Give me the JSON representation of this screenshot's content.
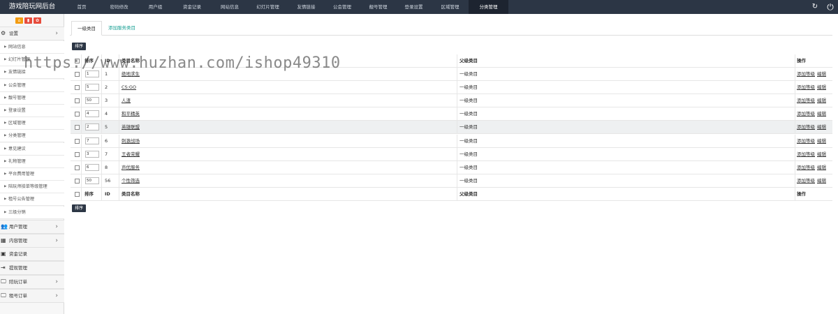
{
  "app": {
    "title": "游戏陪玩网后台"
  },
  "topnav": [
    {
      "label": "首页"
    },
    {
      "label": "密码修改"
    },
    {
      "label": "用户组"
    },
    {
      "label": "资金记录"
    },
    {
      "label": "网站信息"
    },
    {
      "label": "幻灯片管理"
    },
    {
      "label": "友情链接"
    },
    {
      "label": "公会管理"
    },
    {
      "label": "靓号管理"
    },
    {
      "label": "登录设置"
    },
    {
      "label": "区域管理"
    },
    {
      "label": "分类管理",
      "active": true
    }
  ],
  "topright": {
    "refresh_icon": "↻",
    "exit_icon": "⏻"
  },
  "sidebar": {
    "toolbar": [
      {
        "icon": "⌂",
        "color": "#f39c12"
      },
      {
        "icon": "▮",
        "color": "#e74c3c"
      },
      {
        "icon": "✿",
        "color": "#e74c3c"
      }
    ],
    "settings": {
      "label": "设置",
      "icon": "⚙",
      "chevron": "›"
    },
    "settings_items": [
      {
        "label": "网站信息"
      },
      {
        "label": "幻灯片管理"
      },
      {
        "label": "友情链接"
      },
      {
        "label": "公会管理"
      },
      {
        "label": "靓号管理"
      },
      {
        "label": "登录设置"
      },
      {
        "label": "区域管理"
      },
      {
        "label": "分类管理"
      },
      {
        "label": "意见建议"
      },
      {
        "label": "礼物管理"
      },
      {
        "label": "平台费用管理"
      },
      {
        "label": "陪玩师接单等级管理"
      },
      {
        "label": "租号公告管理"
      },
      {
        "label": "三级分销"
      }
    ],
    "sections": [
      {
        "label": "用户管理",
        "icon": "👥",
        "chevron": "›"
      },
      {
        "label": "内容管理",
        "icon": "▦",
        "chevron": "›"
      },
      {
        "label": "资金记录",
        "icon": "▣",
        "chevron": ""
      },
      {
        "label": "提现管理",
        "icon": "⇥",
        "chevron": ""
      },
      {
        "label": "陪玩订单",
        "icon": "🖵",
        "chevron": "›"
      },
      {
        "label": "租号订单",
        "icon": "🖵",
        "chevron": "›"
      }
    ]
  },
  "tabs": {
    "active": "一级类目",
    "link": "添加服务类目"
  },
  "sort_button": "排序",
  "table": {
    "headers": {
      "sort": "排序",
      "id": "ID",
      "name": "类目名称",
      "parent": "父级类目",
      "ops": "操作"
    },
    "rows": [
      {
        "order": "1",
        "id": "1",
        "name": "绝地求生",
        "parent": "一级类目"
      },
      {
        "order": "5",
        "id": "2",
        "name": "CS:GO",
        "parent": "一级类目"
      },
      {
        "order": "50",
        "id": "3",
        "name": "人渣",
        "parent": "一级类目"
      },
      {
        "order": "4",
        "id": "4",
        "name": "和平精英",
        "parent": "一级类目"
      },
      {
        "order": "2",
        "id": "5",
        "name": "英雄联盟",
        "parent": "一级类目",
        "highlight": true
      },
      {
        "order": "7",
        "id": "6",
        "name": "刺激战场",
        "parent": "一级类目"
      },
      {
        "order": "3",
        "id": "7",
        "name": "王者荣耀",
        "parent": "一级类目"
      },
      {
        "order": "6",
        "id": "8",
        "name": "声优服务",
        "parent": "一级类目"
      },
      {
        "order": "50",
        "id": "56",
        "name": "个性筛选",
        "parent": "一级类目"
      }
    ],
    "op_add": "添加等级",
    "op_edit": "编辑"
  },
  "watermark": "https://www.huzhan.com/ishop49310"
}
